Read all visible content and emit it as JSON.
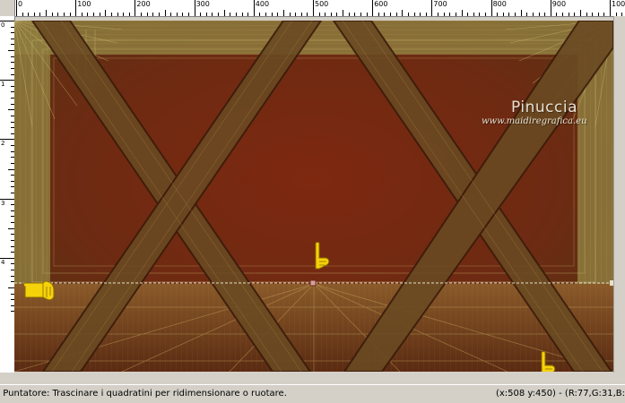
{
  "ruler": {
    "top_labels": [
      "0",
      "100",
      "200",
      "300",
      "400",
      "500",
      "600",
      "700",
      "800",
      "900",
      "1000"
    ],
    "left_labels": [
      "0",
      "1",
      "2",
      "3",
      "4"
    ]
  },
  "canvas": {
    "watermark_title": "Pinuccia",
    "watermark_url": "www.maidiregrafica.eu",
    "colors": {
      "background": "#7a2a14",
      "gold": "#9c8a45",
      "dark_brown": "#4a1e0c",
      "selection_line": "#e8e0c8"
    }
  },
  "icons": {
    "pointer_hand_left": "hand-pointing-right-icon",
    "pointer_hand_top": "hand-pointing-down-icon",
    "pointer_hand_bottom": "hand-pointing-down-icon"
  },
  "status": {
    "left_text": "a Puntatore: Trascinare i quadratini per ridimensionare o ruotare.",
    "right_text": "(x:508 y:450) - (R:77,G:31,B:"
  }
}
